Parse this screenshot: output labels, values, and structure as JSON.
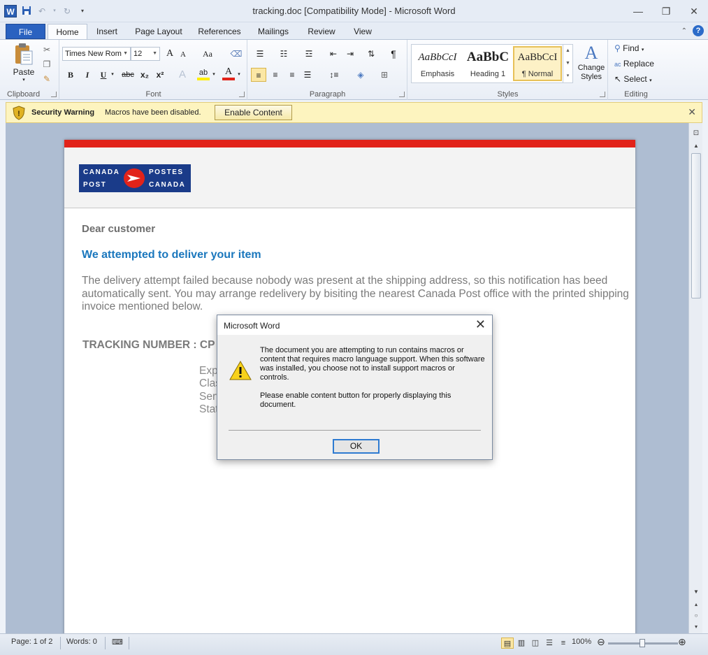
{
  "window": {
    "title": "tracking.doc [Compatibility Mode] - Microsoft Word",
    "app_icon_letter": "W"
  },
  "tabs": {
    "file": "File",
    "items": [
      "Home",
      "Insert",
      "Page Layout",
      "References",
      "Mailings",
      "Review",
      "View"
    ],
    "active": "Home"
  },
  "ribbon": {
    "clipboard": {
      "paste": "Paste",
      "label": "Clipboard"
    },
    "font": {
      "name": "Times New Rom",
      "size": "12",
      "label": "Font",
      "bold": "B",
      "italic": "I",
      "underline": "U",
      "strike": "abc",
      "sub": "x₂",
      "sup": "x²",
      "grow": "A",
      "shrink": "A",
      "case": "Aa",
      "color": "A"
    },
    "paragraph": {
      "label": "Paragraph",
      "pilcrow": "¶"
    },
    "styles": {
      "label": "Styles",
      "items": [
        {
          "sample": "AaBbCcI",
          "name": "Emphasis"
        },
        {
          "sample": "AaBbC",
          "name": "Heading 1"
        },
        {
          "sample": "AaBbCcI",
          "name": "¶ Normal"
        }
      ],
      "change_styles": "Change Styles"
    },
    "editing": {
      "find": "Find",
      "replace": "Replace",
      "select": "Select",
      "label": "Editing"
    }
  },
  "security_bar": {
    "title": "Security Warning",
    "message": "Macros have been disabled.",
    "button": "Enable Content"
  },
  "document": {
    "logo": {
      "canada_en": "CANADA",
      "post_en": "POST",
      "postes_fr": "POSTES",
      "canada_fr": "CANADA"
    },
    "greeting": "Dear customer",
    "heading": "We attempted to deliver your item",
    "paragraph": "The delivery attempt failed because nobody was present at the shipping address, so this notification has beed automatically sent. You may arrange redelivery by bisiting the nearest Canada Post office with the printed shipping invoice mentioned below.",
    "tracking_label": "TRACKING NUMBER : CP",
    "details": [
      "Exp",
      "Clas",
      "Serv",
      "Stat"
    ]
  },
  "dialog": {
    "title": "Microsoft Word",
    "message_1": "The document you are attempting to run contains macros or content that requires macro language support. When this software was installed, you choose not to install support macros or controls.",
    "message_2": "Please enable content button for properly displaying this document.",
    "ok": "OK"
  },
  "status_bar": {
    "page": "Page: 1 of 2",
    "words": "Words: 0",
    "zoom": "100%"
  },
  "colors": {
    "red_stripe": "#e2231a",
    "heading_blue": "#1a77bd",
    "security_bar": "#fdf4bf",
    "file_tab": "#2a62c0"
  }
}
